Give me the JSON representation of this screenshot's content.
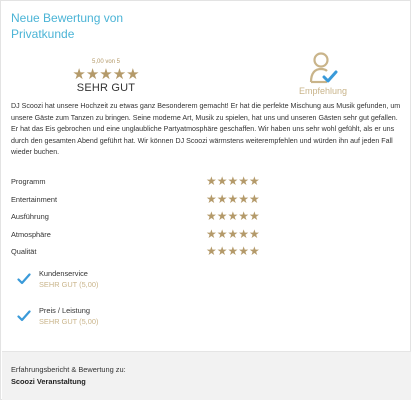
{
  "header": {
    "title": "Neue Bewertung von Privatkunde"
  },
  "score": {
    "label": "5,00 von 5",
    "stars": "★★★★★",
    "text": "SEHR GUT"
  },
  "recommendation": {
    "icon": "user-check-icon",
    "label": "Empfehlung"
  },
  "review": {
    "text": "DJ Scoozi hat unsere Hochzeit zu etwas ganz Besonderem gemacht! Er hat die perfekte Mischung aus Musik gefunden, um unsere Gäste zum Tanzen zu bringen. Seine moderne Art, Musik zu spielen, hat uns und unseren Gästen sehr gut gefallen. Er hat das Eis gebrochen und eine unglaubliche Partyatmosphäre geschaffen. Wir haben uns sehr wohl gefühlt, als er uns durch den gesamten Abend geführt hat. Wir können DJ Scoozi wärmstens weiterempfehlen und würden ihn auf jeden Fall wieder buchen."
  },
  "ratings": [
    {
      "label": "Programm",
      "stars": "★★★★★",
      "value": 5
    },
    {
      "label": "Entertainment",
      "stars": "★★★★★",
      "value": 5
    },
    {
      "label": "Ausführung",
      "stars": "★★★★★",
      "value": 5
    },
    {
      "label": "Atmosphäre",
      "stars": "★★★★★",
      "value": 5
    },
    {
      "label": "Qualität",
      "stars": "★★★★★",
      "value": 5
    }
  ],
  "checks": [
    {
      "title": "Kundenservice",
      "sub": "SEHR GUT (5,00)"
    },
    {
      "title": "Preis / Leistung",
      "sub": "SEHR GUT (5,00)"
    }
  ],
  "footer": {
    "line1": "Erfahrungsbericht & Bewertung zu:",
    "line2": "Scoozi Veranstaltung"
  },
  "colors": {
    "accent_blue": "#4bb4d6",
    "gold": "#b49a6a",
    "check_blue": "#3a9ad9"
  }
}
